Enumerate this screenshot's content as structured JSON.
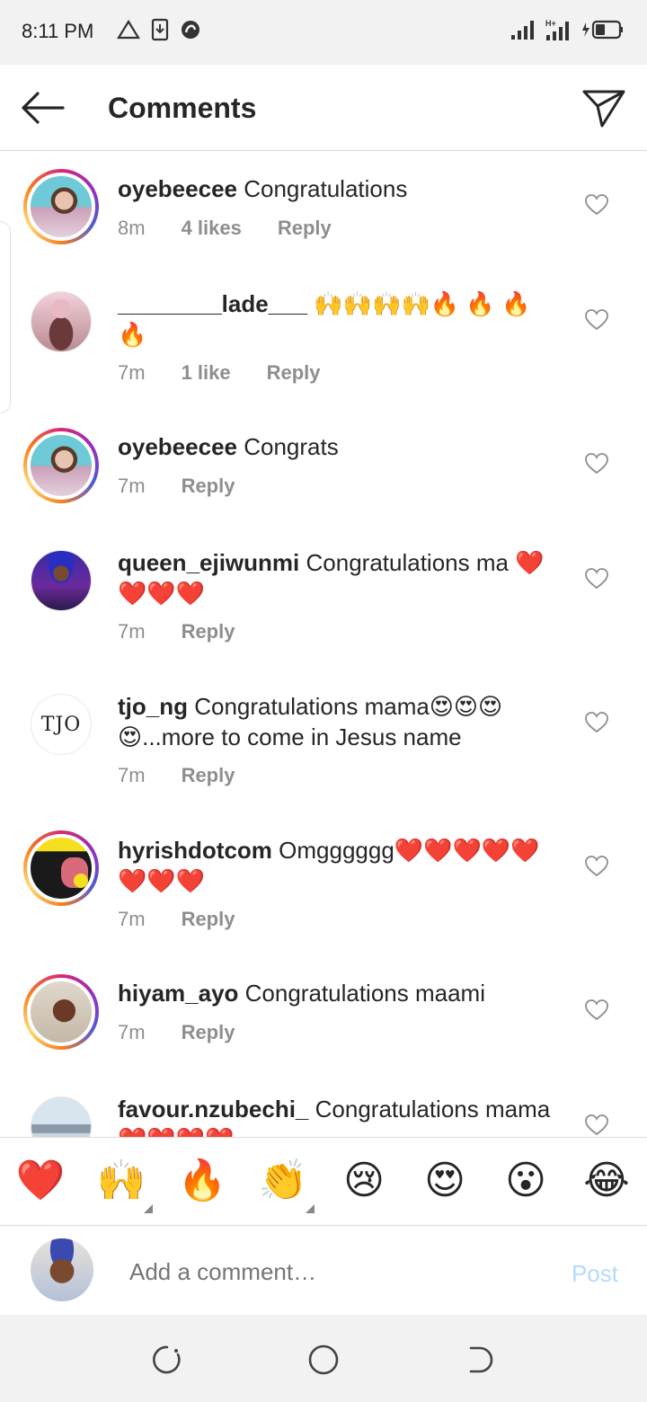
{
  "status_bar": {
    "time": "8:11 PM",
    "icons": [
      "alert-triangle-icon",
      "download-icon",
      "swirl-icon",
      "signal-icon",
      "signal-h-plus-icon",
      "battery-charging-icon"
    ]
  },
  "header": {
    "title": "Comments",
    "back_icon": "arrow-left-icon",
    "share_icon": "send-icon"
  },
  "comments": [
    {
      "username": "oyebeecee",
      "text": "Congratulations",
      "time": "8m",
      "likes": "4 likes",
      "reply": "Reply"
    },
    {
      "username": "________lade___",
      "text": "🙌🙌🙌🙌🔥 🔥 🔥 🔥",
      "time": "7m",
      "likes": "1 like",
      "reply": "Reply"
    },
    {
      "username": "oyebeecee",
      "text": "Congrats",
      "time": "7m",
      "likes": "",
      "reply": "Reply"
    },
    {
      "username": "queen_ejiwunmi",
      "text": "Congratulations ma ❤️❤️❤️❤️",
      "time": "7m",
      "likes": "",
      "reply": "Reply"
    },
    {
      "username": "tjo_ng",
      "text": "Congratulations mama😍😍😍😍...more to come in Jesus name",
      "time": "7m",
      "likes": "",
      "reply": "Reply"
    },
    {
      "username": "hyrishdotcom",
      "text": "Omgggggg❤️❤️❤️❤️❤️❤️❤️❤️",
      "time": "7m",
      "likes": "",
      "reply": "Reply"
    },
    {
      "username": "hiyam_ayo",
      "text": "Congratulations maami",
      "time": "7m",
      "likes": "",
      "reply": "Reply"
    },
    {
      "username": "favour.nzubechi_",
      "text": "Congratulations mama ❤️❤️❤️❤️",
      "time": "",
      "likes": "",
      "reply": ""
    }
  ],
  "tjo_logo_text": "TJO",
  "emoji_bar": [
    "❤️",
    "🙌",
    "🔥",
    "👏",
    "😢",
    "😍",
    "😮",
    "😂"
  ],
  "composer": {
    "placeholder": "Add a comment…",
    "post_label": "Post"
  },
  "navbar": {
    "icons": [
      "recents-icon",
      "home-icon",
      "back-icon"
    ]
  },
  "colors": {
    "text": "#262626",
    "meta": "#8e8e8e",
    "post_disabled": "#b3dbff",
    "status_bg": "#f2f2f2"
  }
}
